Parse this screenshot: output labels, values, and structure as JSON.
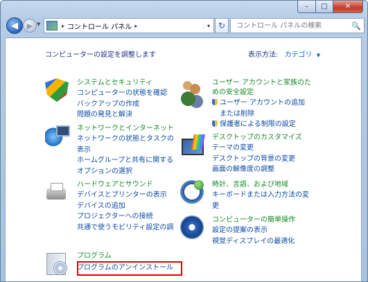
{
  "window": {
    "minimize_glyph": "–",
    "maximize_glyph": "□",
    "close_glyph": "✕"
  },
  "navbar": {
    "back_glyph": "◀",
    "forward_glyph": "▶",
    "history_glyph": "▼",
    "breadcrumb_sep_1": "▸",
    "breadcrumb": "コントロール パネル",
    "breadcrumb_sep_2": "▸",
    "address_dropdown_glyph": "▾",
    "refresh_glyph": "↻",
    "search_placeholder": "コントロール パネルの検索",
    "search_glyph": "🔍"
  },
  "header": {
    "title": "コンピューターの設定を調整します",
    "view_by_label": "表示方法:",
    "view_by_value": "カテゴリ",
    "view_by_arrow": "▼"
  },
  "categories": [
    {
      "icon": "shield-icon",
      "title": "システムとセキュリティ",
      "links": [
        "コンピューターの状態を確認",
        "バックアップの作成",
        "問題の発見と解決"
      ]
    },
    {
      "icon": "users-icon",
      "title": "ユーザー アカウントと家族のた",
      "title2": "めの安全設定",
      "links": [
        "ユーザー アカウントの追加",
        "または削除",
        "保護者による制限の設定"
      ]
    },
    {
      "icon": "network-icon",
      "title": "ネットワークとインターネット",
      "links": [
        "ネットワークの状態とタスクの",
        "表示",
        "ホームグループと共有に関する",
        "オプションの選択"
      ]
    },
    {
      "icon": "desktop-icon",
      "title": "デスクトップのカスタマイズ",
      "links": [
        "テーマの変更",
        "デスクトップの背景の変更",
        "画面の解像度の調整"
      ]
    },
    {
      "icon": "printer-icon",
      "title": "ハードウェアとサウンド",
      "links": [
        "デバイスとプリンターの表示",
        "デバイスの追加",
        "プロジェクターへの接続",
        "共通で使うモビリティ設定の調"
      ]
    },
    {
      "icon": "clock-icon",
      "title": "時計、言語、および地域",
      "links": [
        "キーボードまたは入力方法の変",
        "更"
      ]
    },
    {
      "icon": "ease-of-access-icon",
      "title": "コンピューターの簡単操作",
      "links": [
        "設定の提案の表示",
        "視覚ディスプレイの最適化"
      ]
    },
    {
      "icon": "programs-icon",
      "title": "プログラム",
      "links": [
        "プログラムのアンインストール"
      ]
    }
  ],
  "colors": {
    "category_title": "#138a25",
    "link": "#0a4aa6",
    "highlight_border": "#e00000"
  }
}
